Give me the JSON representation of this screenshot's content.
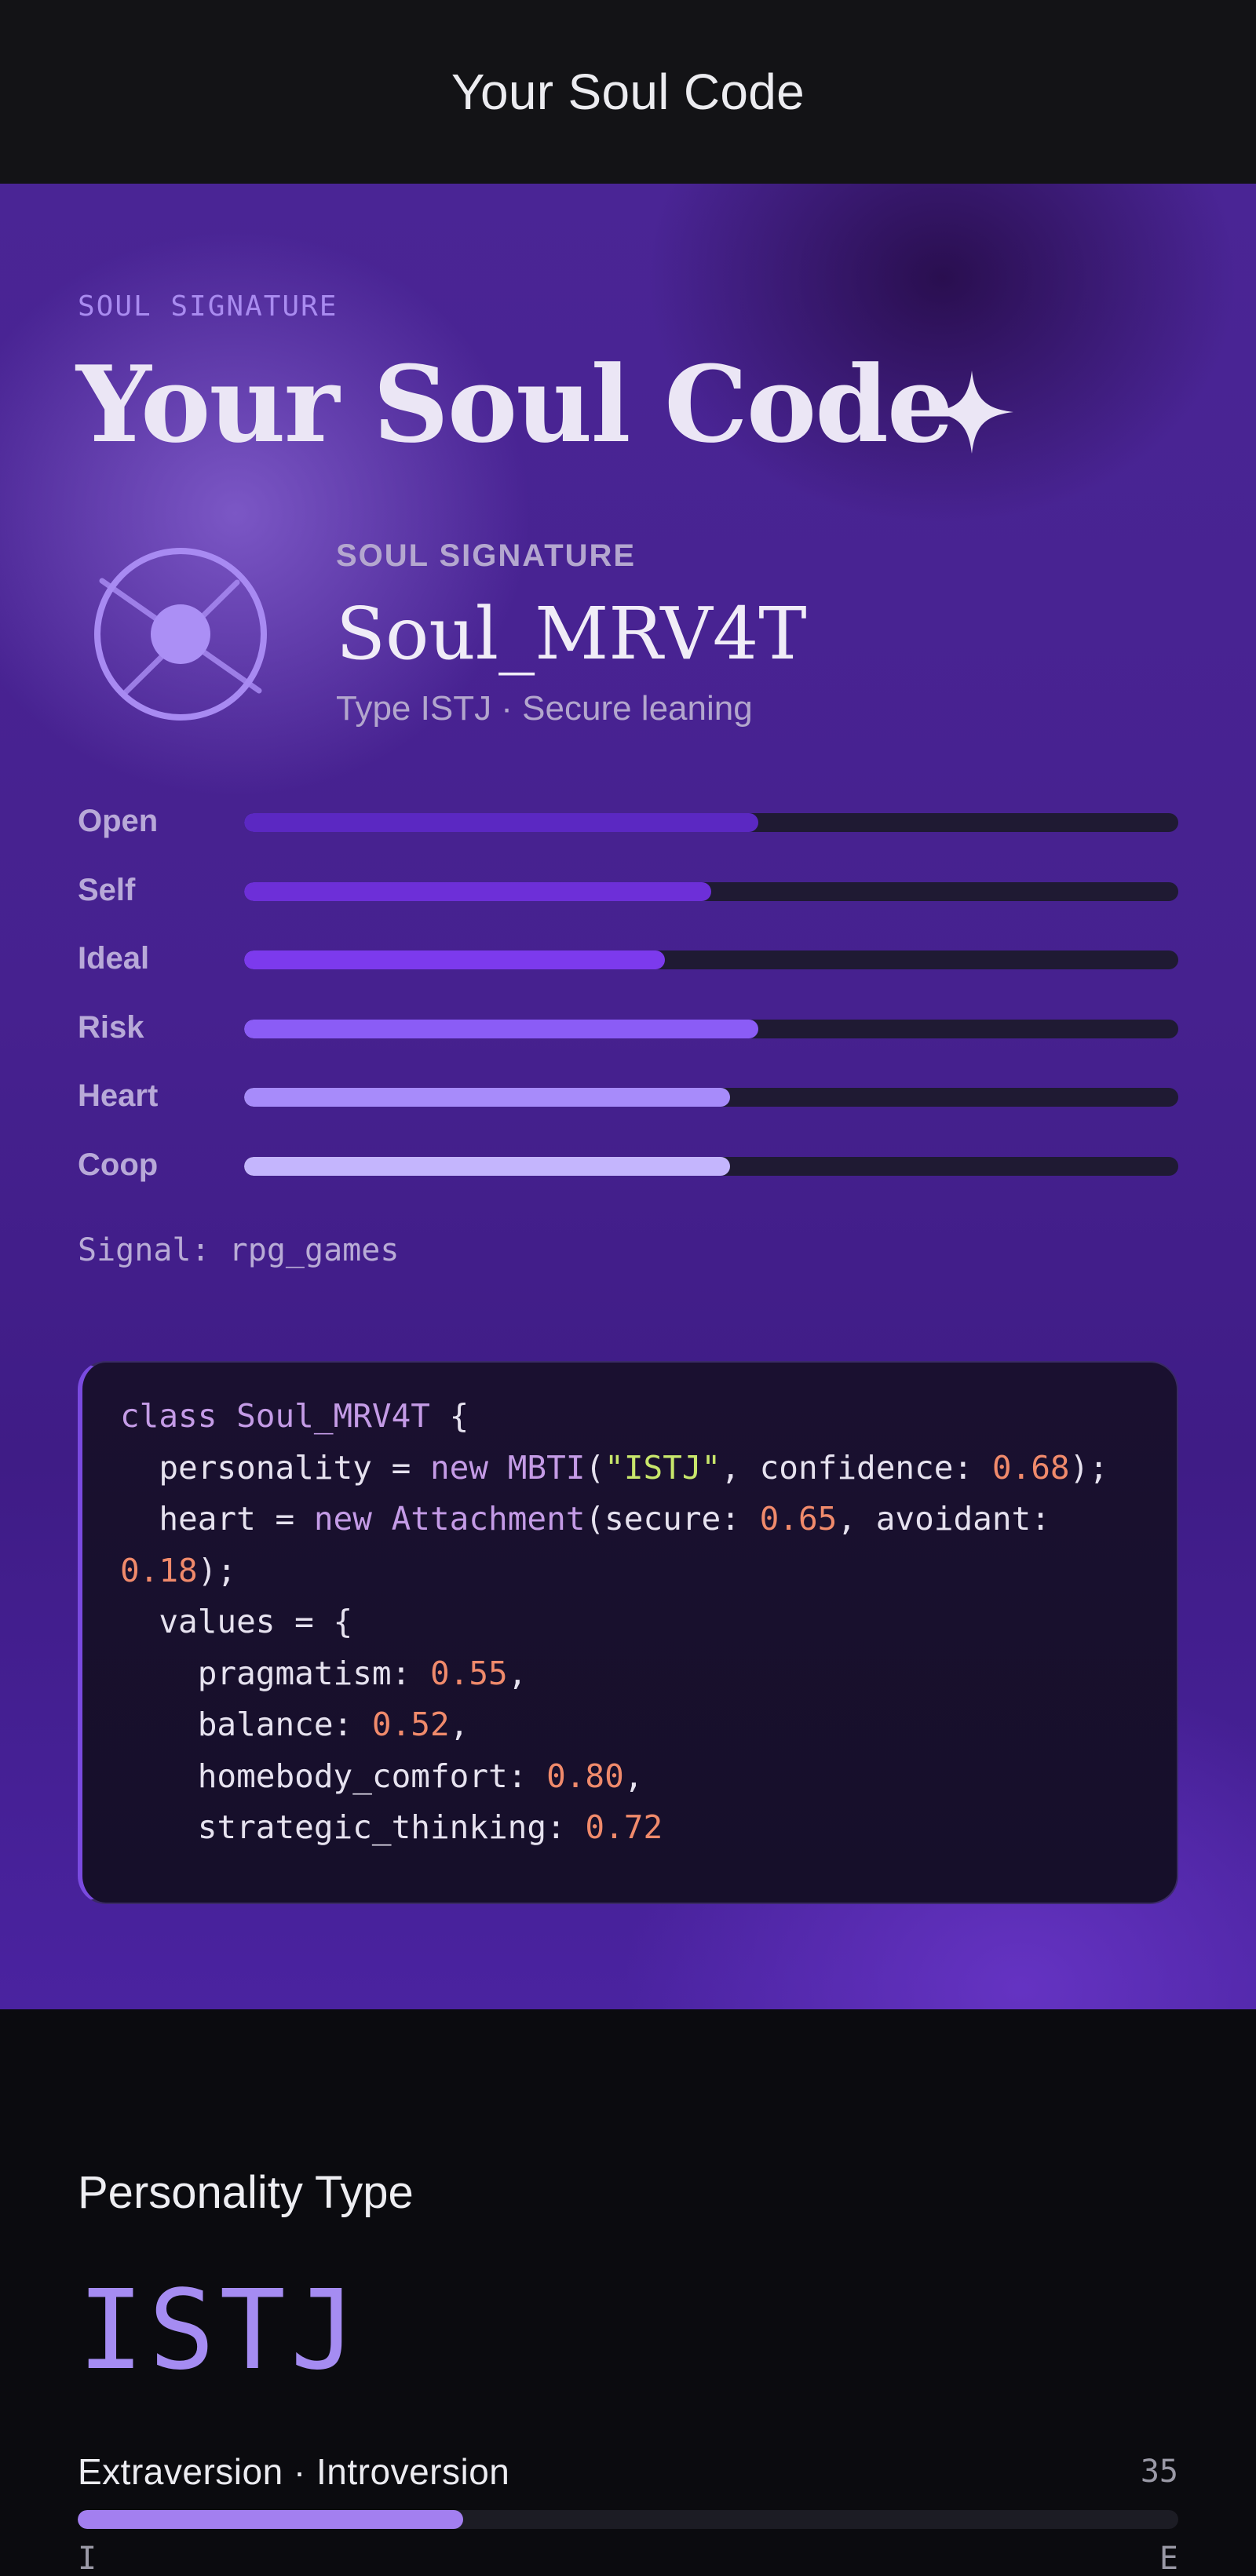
{
  "topbar": {
    "title": "Your Soul Code"
  },
  "hero": {
    "eyebrow": "SOUL SIGNATURE",
    "title": "Your Soul Code",
    "sparkle_icon": "sparkle-icon",
    "emblem_icon": "soul-emblem-icon",
    "signature_label": "SOUL SIGNATURE",
    "signature_name": "Soul_MRV4T",
    "signature_subtitle": "Type ISTJ · Secure leaning"
  },
  "trait_bars": [
    {
      "label": "Open",
      "value": 0.55,
      "color": "#5b28c2"
    },
    {
      "label": "Self",
      "value": 0.5,
      "color": "#6d2fd8"
    },
    {
      "label": "Ideal",
      "value": 0.45,
      "color": "#7c3aed"
    },
    {
      "label": "Risk",
      "value": 0.55,
      "color": "#8b5cf6"
    },
    {
      "label": "Heart",
      "value": 0.52,
      "color": "#a78bfa"
    },
    {
      "label": "Coop",
      "value": 0.52,
      "color": "#c4b5fd"
    }
  ],
  "signal": "Signal: rpg_games",
  "code": {
    "class_kw": "class",
    "class_name": "Soul_MRV4T",
    "open_brace": " {",
    "personality_prefix": "  personality = ",
    "new_kw": "new",
    "mbti_class": "MBTI",
    "mbti_open": "(",
    "mbti_type": "\"ISTJ\"",
    "mbti_confidence_label": ", confidence: ",
    "mbti_confidence": "0.68",
    "mbti_close": ");",
    "heart_prefix": "  heart = ",
    "attachment_class": "Attachment",
    "secure_label": "(secure: ",
    "secure_value": "0.65",
    "avoidant_label": ", avoidant:",
    "avoidant_value": "0.18",
    "attachment_close": ");",
    "values_open": "  values = {",
    "values": [
      {
        "key": "    pragmatism: ",
        "value": "0.55",
        "sep": ","
      },
      {
        "key": "    balance: ",
        "value": "0.52",
        "sep": ","
      },
      {
        "key": "    homebody_comfort: ",
        "value": "0.80",
        "sep": ","
      },
      {
        "key": "    strategic_thinking: ",
        "value": "0.72",
        "sep": ""
      }
    ]
  },
  "personality": {
    "heading": "Personality Type",
    "type": "ISTJ",
    "axis_label": "Extraversion · Introversion",
    "axis_value": "35",
    "axis_fraction": 0.35,
    "axis_left": "I",
    "axis_right": "E"
  },
  "colors": {
    "accent": "#a78bfa",
    "keyword": "#c49be6",
    "string": "#c8e66b",
    "number": "#f08a6b"
  }
}
